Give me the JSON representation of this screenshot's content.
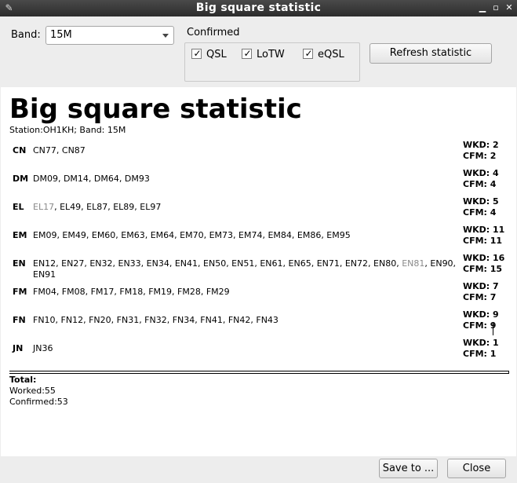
{
  "window": {
    "title": "Big square statistic"
  },
  "toolbar": {
    "band_label": "Band:",
    "band_value": "15M",
    "confirmed_label": "Confirmed",
    "checkboxes": [
      {
        "label": "QSL",
        "checked": true
      },
      {
        "label": "LoTW",
        "checked": true
      },
      {
        "label": "eQSL",
        "checked": true
      }
    ],
    "refresh_label": "Refresh statistic"
  },
  "report": {
    "title": "Big square statistic",
    "subtitle": "Station:OH1KH; Band: 15M",
    "rows": [
      {
        "square": "CN",
        "grids": [
          {
            "t": "CN77, CN87",
            "c": true
          }
        ],
        "wkd": "WKD: 2",
        "cfm": "CFM: 2"
      },
      {
        "square": "DM",
        "grids": [
          {
            "t": "DM09, DM14, DM64, DM93",
            "c": true
          }
        ],
        "wkd": "WKD: 4",
        "cfm": "CFM: 4"
      },
      {
        "square": "EL",
        "grids": [
          {
            "t": "EL17",
            "c": false
          },
          {
            "t": ", EL49, EL87, EL89, EL97",
            "c": true
          }
        ],
        "wkd": "WKD: 5",
        "cfm": "CFM: 4"
      },
      {
        "square": "EM",
        "grids": [
          {
            "t": "EM09, EM49, EM60, EM63, EM64, EM70, EM73, EM74, EM84, EM86, EM95",
            "c": true
          }
        ],
        "wkd": "WKD: 11",
        "cfm": "CFM: 11"
      },
      {
        "square": "EN",
        "grids": [
          {
            "t": "EN12, EN27, EN32, EN33, EN34, EN41, EN50, EN51, EN61, EN65, EN71, EN72, EN80, ",
            "c": true
          },
          {
            "t": "EN81",
            "c": false
          },
          {
            "t": ", EN90, EN91",
            "c": true
          }
        ],
        "wkd": "WKD: 16",
        "cfm": "CFM: 15"
      },
      {
        "square": "FM",
        "grids": [
          {
            "t": "FM04, FM08, FM17, FM18, FM19, FM28, FM29",
            "c": true
          }
        ],
        "wkd": "WKD: 7",
        "cfm": "CFM: 7"
      },
      {
        "square": "FN",
        "grids": [
          {
            "t": "FN10, FN12, FN20, FN31, FN32, FN34, FN41, FN42, FN43",
            "c": true
          }
        ],
        "wkd": "WKD: 9",
        "cfm": "CFM: 9"
      },
      {
        "square": "JN",
        "grids": [
          {
            "t": "JN36",
            "c": true
          }
        ],
        "wkd": "WKD: 1",
        "cfm": "CFM: 1"
      }
    ],
    "totals": {
      "heading": "Total:",
      "worked": "Worked:55",
      "confirmed": "Confirmed:53"
    }
  },
  "footer": {
    "save_label": "Save to ...",
    "close_label": "Close"
  }
}
